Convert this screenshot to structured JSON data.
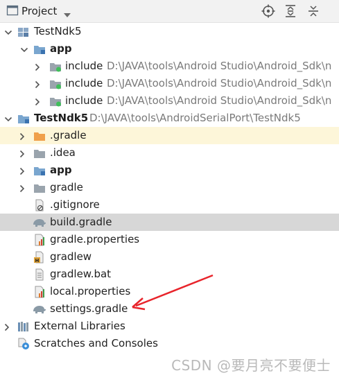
{
  "panel": {
    "title": "Project",
    "icons": [
      "project-view-icon",
      "dropdown-caret-icon",
      "locate-icon",
      "expand-all-icon",
      "collapse-all-icon"
    ]
  },
  "tree": {
    "rows": [
      {
        "label": "TestNdk5",
        "path": ""
      },
      {
        "label": "app",
        "path": ""
      },
      {
        "label": "include",
        "path": "D:\\JAVA\\tools\\Android Studio\\Android_Sdk\\n"
      },
      {
        "label": "include",
        "path": "D:\\JAVA\\tools\\Android Studio\\Android_Sdk\\n"
      },
      {
        "label": "include",
        "path": "D:\\JAVA\\tools\\Android Studio\\Android_Sdk\\n"
      },
      {
        "label": "TestNdk5",
        "path": "D:\\JAVA\\tools\\AndroidSerialPort\\TestNdk5"
      },
      {
        "label": ".gradle",
        "path": ""
      },
      {
        "label": ".idea",
        "path": ""
      },
      {
        "label": "app",
        "path": ""
      },
      {
        "label": "gradle",
        "path": ""
      },
      {
        "label": ".gitignore",
        "path": ""
      },
      {
        "label": "build.gradle",
        "path": ""
      },
      {
        "label": "gradle.properties",
        "path": ""
      },
      {
        "label": "gradlew",
        "path": ""
      },
      {
        "label": "gradlew.bat",
        "path": ""
      },
      {
        "label": "local.properties",
        "path": ""
      },
      {
        "label": "settings.gradle",
        "path": ""
      },
      {
        "label": "External Libraries",
        "path": ""
      },
      {
        "label": "Scratches and Consoles",
        "path": ""
      }
    ]
  },
  "watermark": "CSDN @要月亮不要便士",
  "colors": {
    "toolbar_bg": "#f2f2f2",
    "selected_row_bg": "#d7d7d7",
    "excluded_row_bg": "#fdf6d9",
    "folder_blue": "#7aa6cf",
    "folder_orange": "#f0a04b",
    "annotation_red": "#e8242b"
  }
}
